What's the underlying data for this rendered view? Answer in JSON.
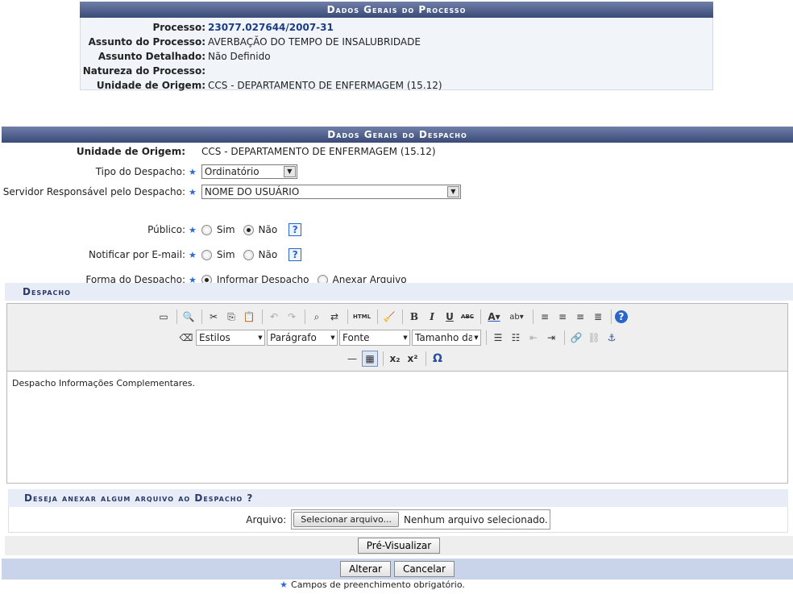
{
  "processo": {
    "caption": "Dados Gerais do Processo",
    "fields": [
      {
        "label": "Processo:",
        "value": "23077.027644/2007-31"
      },
      {
        "label": "Assunto do Processo:",
        "value": "AVERBAÇÃO DO TEMPO DE INSALUBRIDADE"
      },
      {
        "label": "Assunto Detalhado:",
        "value": "Não Definido"
      },
      {
        "label": "Natureza do Processo:",
        "value": ""
      },
      {
        "label": "Unidade de Origem:",
        "value": "CCS - DEPARTAMENTO DE ENFERMAGEM (15.12)"
      }
    ]
  },
  "despacho": {
    "caption": "Dados Gerais do Despacho",
    "unidade_label": "Unidade de Origem:",
    "unidade_value": "CCS - DEPARTAMENTO DE ENFERMAGEM (15.12)",
    "tipo_label": "Tipo do Despacho:",
    "tipo_value": "Ordinatório",
    "servidor_label": "Servidor Responsável pelo Despacho:",
    "servidor_value": "NOME DO USUÁRIO",
    "publico_label": "Público:",
    "notificar_label": "Notificar por E-mail:",
    "sim": "Sim",
    "nao": "Não",
    "forma_label": "Forma do Despacho:",
    "forma_informar": "Informar Despacho",
    "forma_anexar": "Anexar Arquivo",
    "required_mark": "★",
    "help": "?"
  },
  "editor": {
    "section_title": "Despacho",
    "estilos": "Estilos",
    "paragrafo": "Parágrafo",
    "fonte": "Fonte",
    "tamanho": "Tamanho da Fo",
    "content": "Despacho Informações Complementares.",
    "icons": {
      "bold": "B",
      "italic": "I",
      "underline": "U",
      "strike": "ABC",
      "html": "HTML",
      "help": "?",
      "omega": "Ω"
    }
  },
  "anexo": {
    "title": "Deseja anexar algum arquivo ao Despacho ?",
    "arquivo_label": "Arquivo:",
    "file_button": "Selecionar arquivo...",
    "file_status": "Nenhum arquivo selecionado."
  },
  "buttons": {
    "preview": "Pré-Visualizar",
    "alterar": "Alterar",
    "cancelar": "Cancelar"
  },
  "legend": "Campos de preenchimento obrigatório."
}
